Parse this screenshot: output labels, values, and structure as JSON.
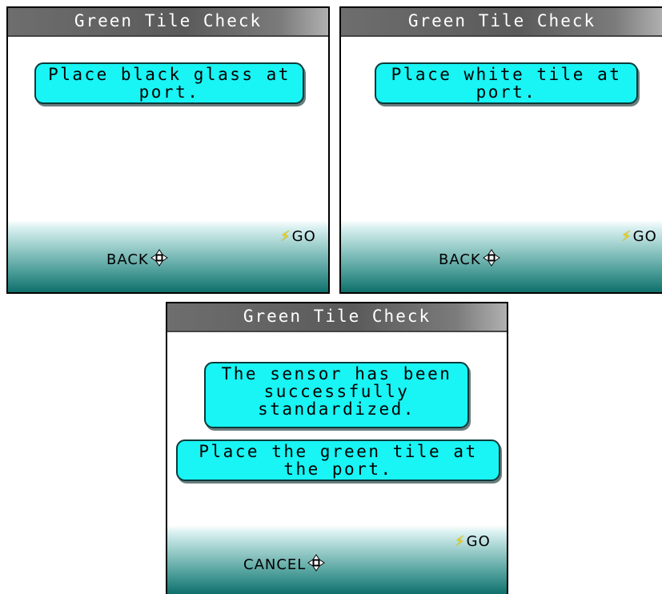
{
  "screens": [
    {
      "title": "Green Tile Check",
      "messages": [
        "Place black glass at\nport."
      ],
      "go_label": "GO",
      "nav_label": "BACK"
    },
    {
      "title": "Green Tile Check",
      "messages": [
        "Place white tile at\nport."
      ],
      "go_label": "GO",
      "nav_label": "BACK"
    },
    {
      "title": "Green Tile Check",
      "messages": [
        "The sensor has been\nsuccessfully\nstandardized.",
        "Place the green tile at\nthe port."
      ],
      "go_label": "GO",
      "nav_label": "CANCEL"
    }
  ],
  "icons": {
    "go": "lightning-bolt-icon",
    "nav": "four-way-dpad-icon"
  },
  "colors": {
    "message_bg": "#19f4f4",
    "footer_dark": "#0f706b",
    "bolt": "#f2d000"
  }
}
